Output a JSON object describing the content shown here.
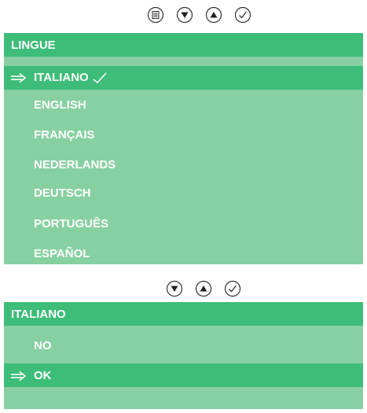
{
  "screen1": {
    "icons": [
      "menu-icon",
      "down-icon",
      "up-icon",
      "confirm-icon"
    ],
    "header": "LINGUE",
    "items": [
      "ITALIANO",
      "ENGLISH",
      "FRANÇAIS",
      "NEDERLANDS",
      "DEUTSCH",
      "PORTUGUÊS",
      "ESPAÑOL"
    ],
    "selected_index": 0
  },
  "screen2": {
    "icons": [
      "down-icon",
      "up-icon",
      "confirm-icon"
    ],
    "header": "ITALIANO",
    "items": [
      "NO",
      "OK"
    ],
    "selected_index": 1
  },
  "colors": {
    "header_green": "#3dbd78",
    "panel_green": "#87d0a2",
    "text": "#ffffff"
  }
}
